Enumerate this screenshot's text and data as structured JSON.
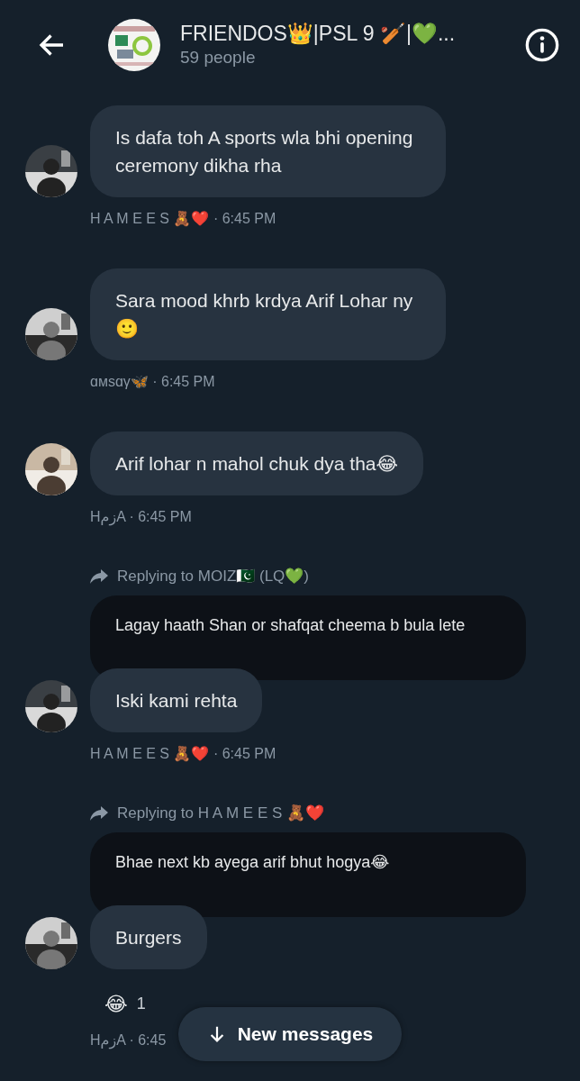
{
  "header": {
    "title": "FRIENDOS👑|PSL 9 🏏|💚...",
    "subtitle": "59 people"
  },
  "groups": [
    {
      "meta": "H A M E E S 🧸❤️ · 6:45 PM",
      "bubbles": [
        "Is dafa toh A sports wla bhi opening ceremony dikha rha"
      ]
    },
    {
      "meta": "ɑᴍѕɑγ🦋 · 6:45 PM",
      "bubbles": [
        "Sara mood khrb krdya Arif Lohar ny🙂"
      ]
    },
    {
      "meta": "HزمA · 6:45 PM",
      "bubbles": [
        "Arif lohar n mahol chuk dya tha😂"
      ]
    },
    {
      "meta": "H A M E E S 🧸❤️ · 6:45 PM",
      "reply": {
        "label": "Replying to MOIZ🇵🇰 (LQ💚)",
        "quoted": "Lagay haath Shan or shafqat cheema b bula lete"
      },
      "bubbles": [
        "Iski kami rehta"
      ]
    },
    {
      "meta": "HزمA · 6:45",
      "reply": {
        "label": "Replying to H A M E E S 🧸❤️",
        "quoted": "Bhae next kb ayega arif bhut hogya😂"
      },
      "bubbles": [
        "Burgers"
      ],
      "reaction": {
        "emoji": "😂",
        "count": "1"
      }
    }
  ],
  "new_messages_button": "New messages"
}
